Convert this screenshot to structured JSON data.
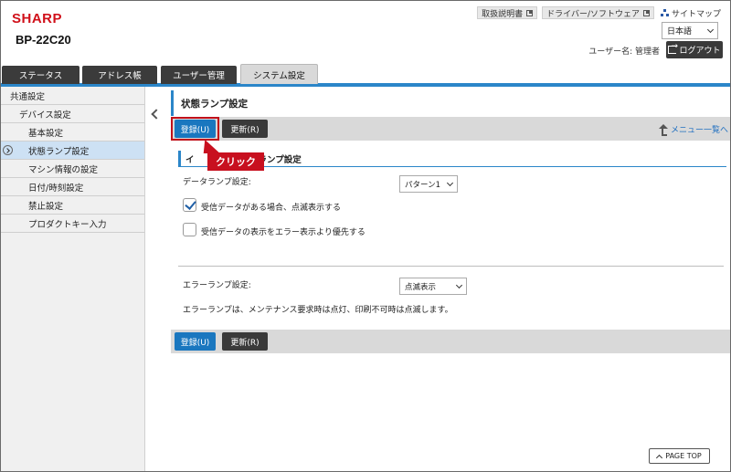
{
  "brand": {
    "logo": "SHARP",
    "model": "BP-22C20",
    "logo_color": "#d0101a"
  },
  "top_links": {
    "manual": "取扱説明書",
    "driver": "ドライバー/ソフトウェア",
    "sitemap": "サイトマップ"
  },
  "language": {
    "selected": "日本語"
  },
  "user": {
    "label": "ユーザー名: 管理者",
    "logout": "ログアウト"
  },
  "tabs": [
    {
      "label": "ステータス"
    },
    {
      "label": "アドレス帳"
    },
    {
      "label": "ユーザー管理"
    },
    {
      "label": "システム設定",
      "active": true
    }
  ],
  "sidebar": {
    "items": [
      {
        "label": "共通設定",
        "level": 0
      },
      {
        "label": "デバイス設定",
        "level": 1
      },
      {
        "label": "基本設定",
        "level": 2
      },
      {
        "label": "状態ランプ設定",
        "level": 2,
        "active": true
      },
      {
        "label": "マシン情報の設定",
        "level": 2
      },
      {
        "label": "日付/時刻設定",
        "level": 2
      },
      {
        "label": "禁止設定",
        "level": 2
      },
      {
        "label": "プロダクトキー入力",
        "level": 2
      }
    ]
  },
  "main": {
    "title": "状態ランプ設定",
    "register_label": "登録(U)",
    "refresh_label": "更新(R)",
    "menu_link": "メニュー一覧へ",
    "callout": "クリック",
    "section_title_left": "イ",
    "section_title_right": "ランプ設定",
    "data_lamp_label": "データランプ設定:",
    "data_lamp_value": "パターン1",
    "check1_label": "受信データがある場合、点滅表示する",
    "check1_checked": true,
    "check2_label": "受信データの表示をエラー表示より優先する",
    "check2_checked": false,
    "error_lamp_label": "エラーランプ設定:",
    "error_lamp_value": "点滅表示",
    "error_note": "エラーランプは、メンテナンス要求時は点灯、印刷不可時は点滅します。",
    "page_top": "PAGE TOP"
  },
  "colors": {
    "accent": "#2b86c9",
    "primary_button": "#1a77bf",
    "callout": "#c8101f",
    "active_item": "#cde1f4"
  }
}
